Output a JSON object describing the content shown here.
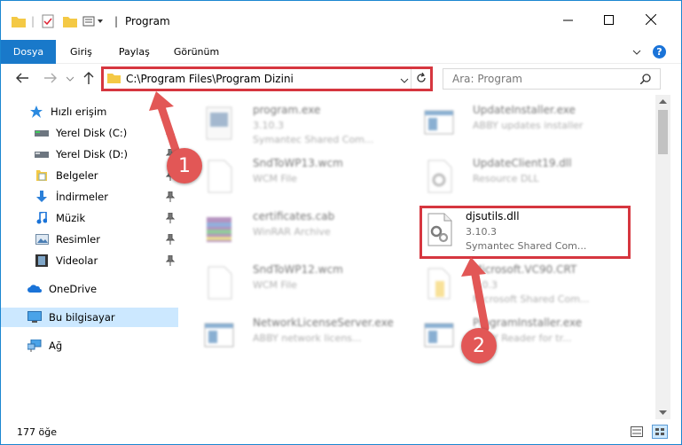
{
  "window": {
    "title": "Program"
  },
  "ribbon": {
    "tabs": [
      "Dosya",
      "Giriş",
      "Paylaş",
      "Görünüm"
    ]
  },
  "address": {
    "path": "C:\\Program Files\\Program Dizini"
  },
  "search": {
    "placeholder": "Ara: Program"
  },
  "sidebar": {
    "items": [
      {
        "label": "Hızlı erişim"
      },
      {
        "label": "Yerel Disk (C:)"
      },
      {
        "label": "Yerel Disk (D:)"
      },
      {
        "label": "Belgeler"
      },
      {
        "label": "İndirmeler"
      },
      {
        "label": "Müzik"
      },
      {
        "label": "Resimler"
      },
      {
        "label": "Videolar"
      },
      {
        "label": "OneDrive"
      },
      {
        "label": "Bu bilgisayar"
      },
      {
        "label": "Ağ"
      }
    ]
  },
  "files": [
    {
      "name": "program.exe",
      "line2": "3.10.3",
      "line3": "Symantec Shared Com..."
    },
    {
      "name": "UpdateInstaller.exe",
      "line2": "ABBY updates installer",
      "line3": ""
    },
    {
      "name": "SndToWP13.wcm",
      "line2": "WCM File",
      "line3": ""
    },
    {
      "name": "UpdateClient19.dll",
      "line2": "Resource DLL",
      "line3": ""
    },
    {
      "name": "certificates.cab",
      "line2": "WinRAR Archive",
      "line3": ""
    },
    {
      "name": "djsutils.dll",
      "line2": "3.10.3",
      "line3": "Symantec Shared Com..."
    },
    {
      "name": "SndToWP12.wcm",
      "line2": "WCM File",
      "line3": ""
    },
    {
      "name": "Microsoft.VC90.CRT",
      "line2": "9.0.3",
      "line3": "Microsoft Shared Com..."
    },
    {
      "name": "NetworkLicenseServer.exe",
      "line2": "ABBY network licens...",
      "line3": ""
    },
    {
      "name": "ProgramInstaller.exe",
      "line2": "ABBY Reader for tr...",
      "line3": ""
    }
  ],
  "status": {
    "count": "177 öğe"
  },
  "annotations": {
    "one": "1",
    "two": "2"
  }
}
